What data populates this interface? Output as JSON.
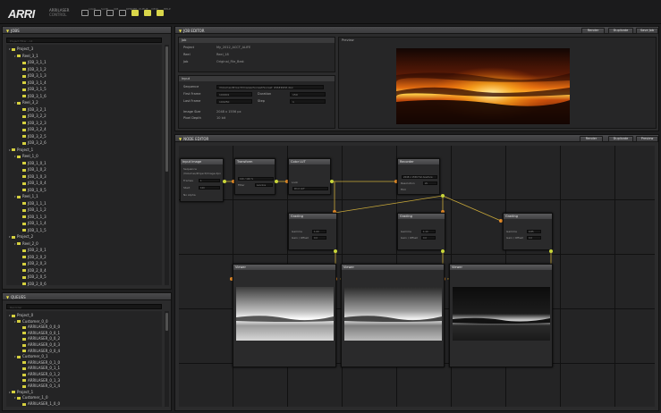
{
  "app": {
    "logo": "ARRI",
    "brand_line1": "ARRILASER",
    "brand_line2": "CONTROL",
    "toolbar": [
      {
        "label": "LOAD",
        "icon": "load-icon",
        "active": false
      },
      {
        "label": "SAVE",
        "icon": "save-icon",
        "active": false
      },
      {
        "label": "JOB",
        "icon": "job-icon",
        "active": false
      },
      {
        "label": "RENDER",
        "icon": "render-icon",
        "active": false
      },
      {
        "label": "QUEUE",
        "icon": "queue-icon",
        "active": true
      },
      {
        "label": "VIEW",
        "icon": "view-icon",
        "active": true
      },
      {
        "label": "HELP",
        "icon": "help-icon",
        "active": true
      }
    ]
  },
  "jobs_panel": {
    "title": "JOBS",
    "filter_placeholder": "Project Filter - All",
    "items": [
      {
        "label": "Project_3",
        "level": 0,
        "expanded": true
      },
      {
        "label": "Reel_3_1",
        "level": 1,
        "expanded": true
      },
      {
        "label": "JOB_3_1_1",
        "level": 2
      },
      {
        "label": "JOB_3_1_2",
        "level": 2
      },
      {
        "label": "JOB_3_1_3",
        "level": 2
      },
      {
        "label": "JOB_3_1_4",
        "level": 2
      },
      {
        "label": "JOB_3_1_5",
        "level": 2
      },
      {
        "label": "JOB_3_1_6",
        "level": 2
      },
      {
        "label": "Reel_3_2",
        "level": 1,
        "expanded": true
      },
      {
        "label": "JOB_3_2_1",
        "level": 2
      },
      {
        "label": "JOB_3_2_2",
        "level": 2
      },
      {
        "label": "JOB_3_2_3",
        "level": 2
      },
      {
        "label": "JOB_3_2_4",
        "level": 2
      },
      {
        "label": "JOB_3_2_5",
        "level": 2
      },
      {
        "label": "JOB_3_2_6",
        "level": 2
      },
      {
        "label": "Project_1",
        "level": 0,
        "expanded": true
      },
      {
        "label": "Reel_1_0",
        "level": 1,
        "expanded": true
      },
      {
        "label": "JOB_1_0_1",
        "level": 2
      },
      {
        "label": "JOB_1_0_2",
        "level": 2
      },
      {
        "label": "JOB_1_0_3",
        "level": 2
      },
      {
        "label": "JOB_1_0_4",
        "level": 2
      },
      {
        "label": "JOB_1_0_5",
        "level": 2
      },
      {
        "label": "Reel_1_1",
        "level": 1,
        "expanded": true
      },
      {
        "label": "JOB_1_1_1",
        "level": 2
      },
      {
        "label": "JOB_1_1_2",
        "level": 2
      },
      {
        "label": "JOB_1_1_3",
        "level": 2
      },
      {
        "label": "JOB_1_1_4",
        "level": 2
      },
      {
        "label": "JOB_1_1_5",
        "level": 2
      },
      {
        "label": "Project_2",
        "level": 0,
        "expanded": true
      },
      {
        "label": "Reel_2_0",
        "level": 1,
        "expanded": true
      },
      {
        "label": "JOB_2_0_1",
        "level": 2
      },
      {
        "label": "JOB_2_0_2",
        "level": 2
      },
      {
        "label": "JOB_2_0_3",
        "level": 2
      },
      {
        "label": "JOB_2_0_4",
        "level": 2
      },
      {
        "label": "JOB_2_0_5",
        "level": 2
      },
      {
        "label": "JOB_2_0_6",
        "level": 2
      }
    ]
  },
  "queues_panel": {
    "title": "QUEUES",
    "filter_placeholder": "Recorder",
    "items": [
      {
        "label": "Project_0",
        "level": 0,
        "expanded": true
      },
      {
        "label": "Customer_0_0",
        "level": 1,
        "expanded": true
      },
      {
        "label": "ARRILASER_0_0_0",
        "level": 2
      },
      {
        "label": "ARRILASER_0_0_1",
        "level": 2
      },
      {
        "label": "ARRILASER_0_0_2",
        "level": 2
      },
      {
        "label": "ARRILASER_0_0_3",
        "level": 2
      },
      {
        "label": "ARRILASER_0_0_4",
        "level": 2
      },
      {
        "label": "Customer_0_1",
        "level": 1,
        "expanded": true
      },
      {
        "label": "ARRILASER_0_1_0",
        "level": 2
      },
      {
        "label": "ARRILASER_0_1_1",
        "level": 2
      },
      {
        "label": "ARRILASER_0_1_2",
        "level": 2
      },
      {
        "label": "ARRILASER_0_1_3",
        "level": 2
      },
      {
        "label": "ARRILASER_0_1_4",
        "level": 2
      },
      {
        "label": "Project_1",
        "level": 0,
        "expanded": true
      },
      {
        "label": "Customer_1_0",
        "level": 1,
        "expanded": true
      },
      {
        "label": "ARRILASER_1_0_0",
        "level": 2
      }
    ]
  },
  "job_editor": {
    "title": "JOB EDITOR",
    "buttons": [
      "Render",
      "Duplicate",
      "Save Job"
    ],
    "job_section": "Job",
    "job_rows": [
      {
        "label": "Project",
        "value": "My_2012_ACCT_ALIFE"
      },
      {
        "label": "Reel",
        "value": "Reel_18"
      },
      {
        "label": "Job",
        "value": "Original_File_Best"
      }
    ],
    "input_section": "Input",
    "sequence_label": "Sequence",
    "sequence_value": "/Volumes/Project/Images/Sunset/Sunset_######.dpx",
    "first_frame_label": "First Frame",
    "first_frame_value": "100001",
    "last_frame_label": "Last Frame",
    "last_frame_value": "100250",
    "duration_label": "Duration",
    "duration_value": "150",
    "step_label": "Step",
    "step_value": "1",
    "image_size_label": "Image Size",
    "image_size_value": "2048 x 1556 px",
    "pixel_depth_label": "Pixel Depth",
    "pixel_depth_value": "10 bit",
    "preview_label": "Preview"
  },
  "node_editor": {
    "title": "NODE EDITOR",
    "buttons": [
      "Render",
      "Duplicate",
      "Preview"
    ],
    "nodes": {
      "input": {
        "title": "Input Image",
        "l1": "Sequence",
        "l2": "/Volumes/Project/Image.dpx",
        "l3": "Frames",
        "l4": "Start",
        "l5": "End",
        "v1": "1",
        "v2": "100",
        "l6": "No Alpha"
      },
      "transform": {
        "title": "Transform",
        "l1": "Scale",
        "v1": "100 / 100 %",
        "l2": "Filter",
        "v2": "Lanczos"
      },
      "lut": {
        "title": "Color LUT",
        "l1": "Look",
        "v1": "Print_LUT",
        "l2": "Depth",
        "v2": "10 bit"
      },
      "output": {
        "title": "Recorder",
        "l1": "Format",
        "v1": "2048 x 1556 Full Aperture",
        "l2": "Resolution",
        "v2": "2k",
        "l3": "Film",
        "v3": "Kodak 2383"
      },
      "grade1": {
        "title": "Grading",
        "l1": "Gamma",
        "v1": "1.00",
        "l2": "Gain / Offset",
        "v2": "0.0"
      },
      "grade2": {
        "title": "Grading",
        "l1": "Gamma",
        "v1": "1.10",
        "l2": "Gain / Offset",
        "v2": "0.0"
      },
      "grade3": {
        "title": "Grading",
        "l1": "Gamma",
        "v1": "0.85",
        "l2": "Gain / Offset",
        "v2": "0.0"
      },
      "viewer1": {
        "title": "Viewer"
      },
      "viewer2": {
        "title": "Viewer"
      },
      "viewer3": {
        "title": "Viewer"
      }
    }
  }
}
